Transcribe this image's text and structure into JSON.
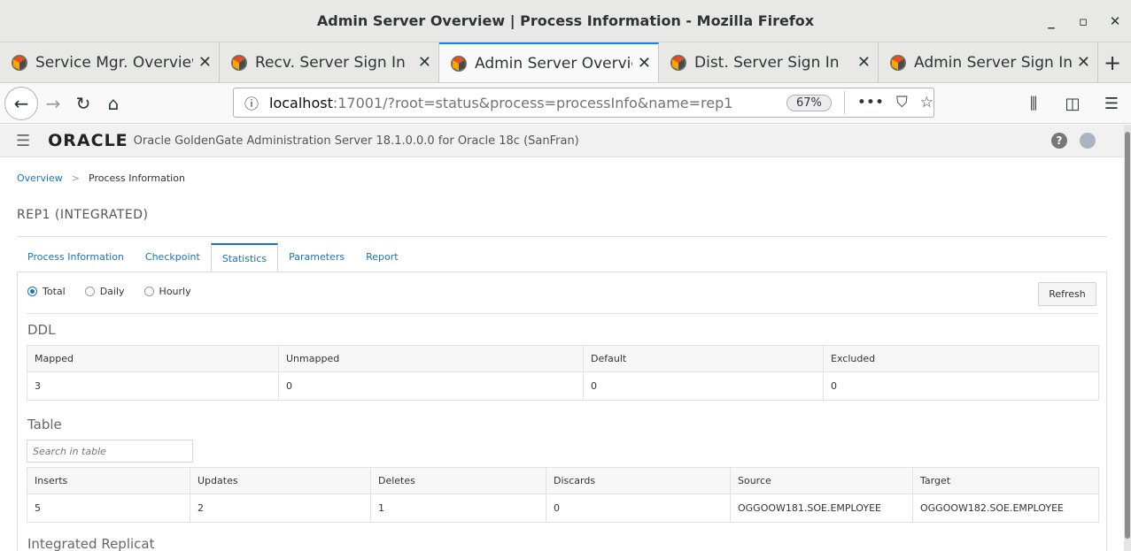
{
  "window": {
    "title": "Admin Server Overview | Process Information - Mozilla Firefox"
  },
  "tabs": [
    {
      "label": "Service Mgr. Overview"
    },
    {
      "label": "Recv. Server Sign In"
    },
    {
      "label": "Admin Server Overview"
    },
    {
      "label": "Dist. Server Sign In"
    },
    {
      "label": "Admin Server Sign In"
    }
  ],
  "nav": {
    "url_host": "localhost",
    "url_rest": ":17001/?root=status&process=processInfo&name=rep1",
    "zoom": "67%"
  },
  "app": {
    "brand": "ORACLE",
    "title": "Oracle GoldenGate Administration Server 18.1.0.0.0 for Oracle 18c (SanFran)"
  },
  "breadcrumb": {
    "home": "Overview",
    "separator": ">",
    "current": "Process Information"
  },
  "page_title": "REP1 (INTEGRATED)",
  "subtabs": [
    "Process Information",
    "Checkpoint",
    "Statistics",
    "Parameters",
    "Report"
  ],
  "radios": [
    "Total",
    "Daily",
    "Hourly"
  ],
  "refresh_label": "Refresh",
  "ddl": {
    "heading": "DDL",
    "columns": [
      "Mapped",
      "Unmapped",
      "Default",
      "Excluded"
    ],
    "row": [
      "3",
      "0",
      "0",
      "0"
    ]
  },
  "table": {
    "heading": "Table",
    "search_placeholder": "Search in table",
    "columns": [
      "Inserts",
      "Updates",
      "Deletes",
      "Discards",
      "Source",
      "Target"
    ],
    "row": [
      "5",
      "2",
      "1",
      "0",
      "OGGOOW181.SOE.EMPLOYEE",
      "OGGOOW182.SOE.EMPLOYEE"
    ]
  },
  "integrated_heading": "Integrated Replicat"
}
